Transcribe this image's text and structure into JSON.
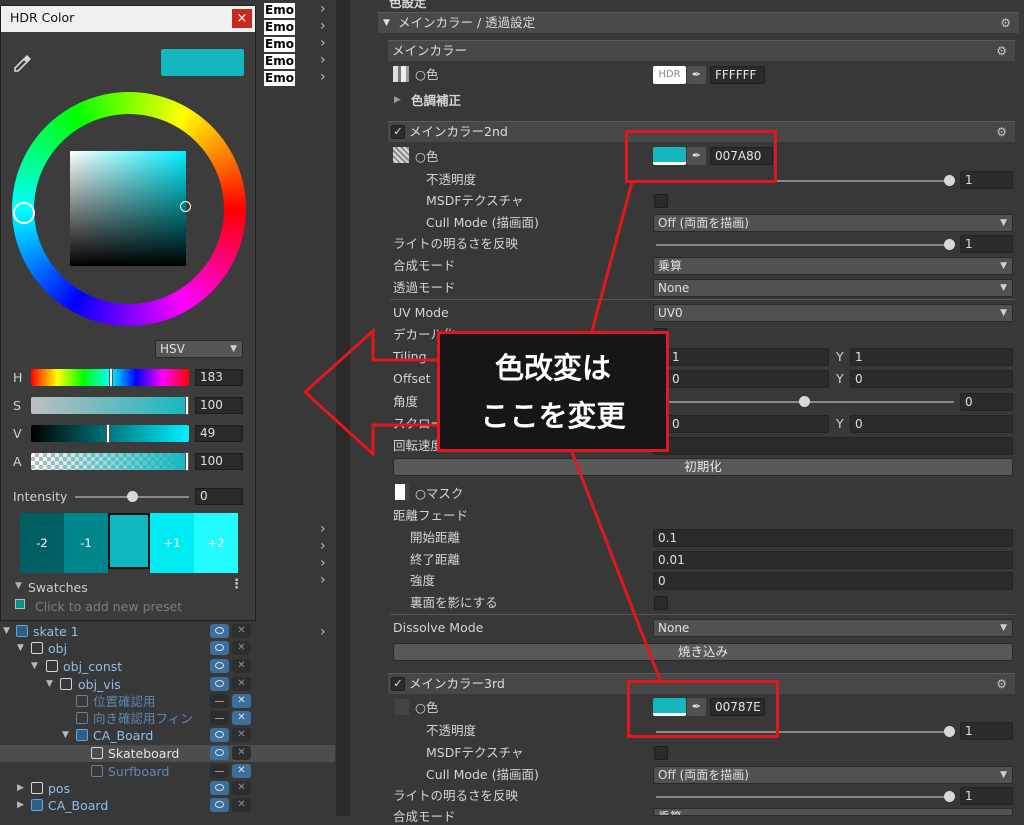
{
  "hierarchy": {
    "emo_label": "Emo",
    "rows": [
      {
        "name": "skate 1",
        "depth": 0,
        "expanded": true,
        "blue": false
      },
      {
        "name": "obj",
        "depth": 1,
        "expanded": true,
        "blue": false
      },
      {
        "name": "obj_const",
        "depth": 2,
        "expanded": true,
        "blue": false
      },
      {
        "name": "obj_vis",
        "depth": 3,
        "expanded": true,
        "blue": false
      },
      {
        "name": "位置確認用",
        "depth": 4,
        "expanded": false,
        "blue": true
      },
      {
        "name": "向き確認用フィン",
        "depth": 4,
        "expanded": false,
        "blue": true
      },
      {
        "name": "CA_Board",
        "depth": 4,
        "expanded": true,
        "blue": false
      },
      {
        "name": "Skateboard",
        "depth": 5,
        "expanded": false,
        "blue": false
      },
      {
        "name": "Surfboard",
        "depth": 5,
        "expanded": false,
        "blue": true
      },
      {
        "name": "pos",
        "depth": 1,
        "expanded": false,
        "blue": false
      },
      {
        "name": "CA_Board",
        "depth": 1,
        "expanded": false,
        "blue": false
      }
    ]
  },
  "hdr_color": {
    "title": "HDR Color",
    "close": "×",
    "current_color": "#15b6bd",
    "mode": "HSV",
    "sliders": [
      {
        "label": "H",
        "value": "183",
        "fill": 0.508
      },
      {
        "label": "S",
        "value": "100",
        "fill": 1.0
      },
      {
        "label": "V",
        "value": "49",
        "fill": 0.49
      },
      {
        "label": "A",
        "value": "100",
        "fill": 1.0
      }
    ],
    "intensity_label": "Intensity",
    "intensity_value": "0",
    "swatches": [
      "-2",
      "-1",
      "",
      "+1",
      "+2"
    ],
    "swatches_label": "Swatches",
    "preset_hint": "Click to add new preset"
  },
  "inspector": {
    "top_label": "色設定",
    "section_main": "メインカラー / 透過設定",
    "main_color": {
      "header": "メインカラー",
      "color_label": "○色",
      "hdr_label": "HDR",
      "hex": "FFFFFF",
      "tone_label": "色調補正"
    },
    "main2": {
      "header": "メインカラー2nd",
      "color_label": "○色",
      "hex": "007A80",
      "opacity_label": "不透明度",
      "opacity_value": "1",
      "msdf_label": "MSDFテクスチャ",
      "cull_label": "Cull Mode (描画面)",
      "cull_value": "Off (両面を描画)",
      "light_label": "ライトの明るさを反映",
      "light_value": "1",
      "blend_label": "合成モード",
      "blend_value": "乗算",
      "alpha_label": "透過モード",
      "alpha_value": "None",
      "uv_label": "UV Mode",
      "uv_value": "UV0",
      "decal_label": "デカール化",
      "tiling_label": "Tiling",
      "tiling_x": "1",
      "tiling_y": "1",
      "offset_label": "Offset",
      "offset_x": "0",
      "offset_y": "0",
      "angle_label": "角度",
      "angle_value": "0",
      "scroll_label": "スクロール",
      "scroll_x": "0",
      "scroll_y": "0",
      "rot_label": "回転速度",
      "rot_value": "0",
      "reset_button": "初期化",
      "mask_label": "○マスク",
      "fade_label": "距離フェード",
      "fade_start_label": "開始距離",
      "fade_start": "0.1",
      "fade_end_label": "終了距離",
      "fade_end": "0.01",
      "strength_label": "強度",
      "strength": "0",
      "backface_label": "裏面を影にする",
      "dissolve_label": "Dissolve Mode",
      "dissolve_value": "None",
      "bake_button": "焼き込み"
    },
    "main3": {
      "header": "メインカラー3rd",
      "color_label": "○色",
      "hex": "00787E",
      "opacity_label": "不透明度",
      "opacity_value": "1",
      "msdf_label": "MSDFテクスチャ",
      "cull_label": "Cull Mode (描画面)",
      "cull_value": "Off (両面を描画)",
      "light_label": "ライトの明るさを反映",
      "light_value": "1",
      "blend_label": "合成モード",
      "blend_value": "乗算"
    },
    "axis_x": "X",
    "axis_y": "Y"
  },
  "annotation": {
    "line1": "色改変は",
    "line2": "ここを変更"
  },
  "colors": {
    "accent_red": "#e0181d",
    "teal": "#15b6bd"
  }
}
